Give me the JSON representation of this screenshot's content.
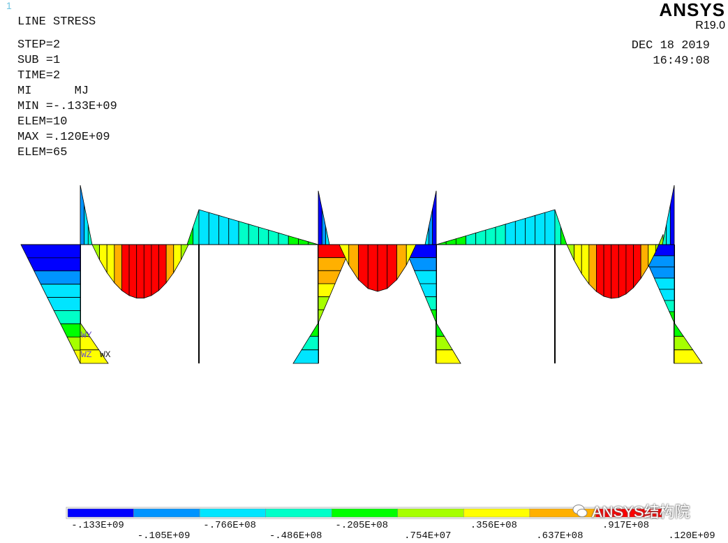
{
  "window": {
    "number": "1"
  },
  "header": {
    "title": "LINE STRESS",
    "lines": [
      "STEP=2",
      "SUB =1",
      "TIME=2",
      "MI      MJ",
      "MIN =-.133E+09",
      "ELEM=10",
      "MAX =.120E+09",
      "ELEM=65"
    ]
  },
  "brand": {
    "name": "ANSYS",
    "version": "R19.0"
  },
  "timestamp": {
    "date": "DEC 18 2019",
    "time": "16:49:08"
  },
  "legend": {
    "colors": [
      "#0000ff",
      "#0094ff",
      "#00e5ff",
      "#00ffc8",
      "#00ff00",
      "#a6ff00",
      "#ffff00",
      "#ffb000",
      "#ff0000"
    ],
    "labels_top": [
      ".133E+09",
      "-.766E+08",
      "-.205E+08",
      ".356E+08",
      ".917E+08"
    ],
    "labels_top_prefix": [
      "-",
      "",
      "",
      "",
      ""
    ],
    "labels_bottom": [
      "-.105E+09",
      "-.486E+08",
      ".754E+07",
      ".637E+08",
      ".120E+09"
    ]
  },
  "triad": {
    "y": "WY",
    "z": "WZ",
    "x": "WX"
  },
  "watermark": {
    "text": "ANSYS结构院"
  }
}
